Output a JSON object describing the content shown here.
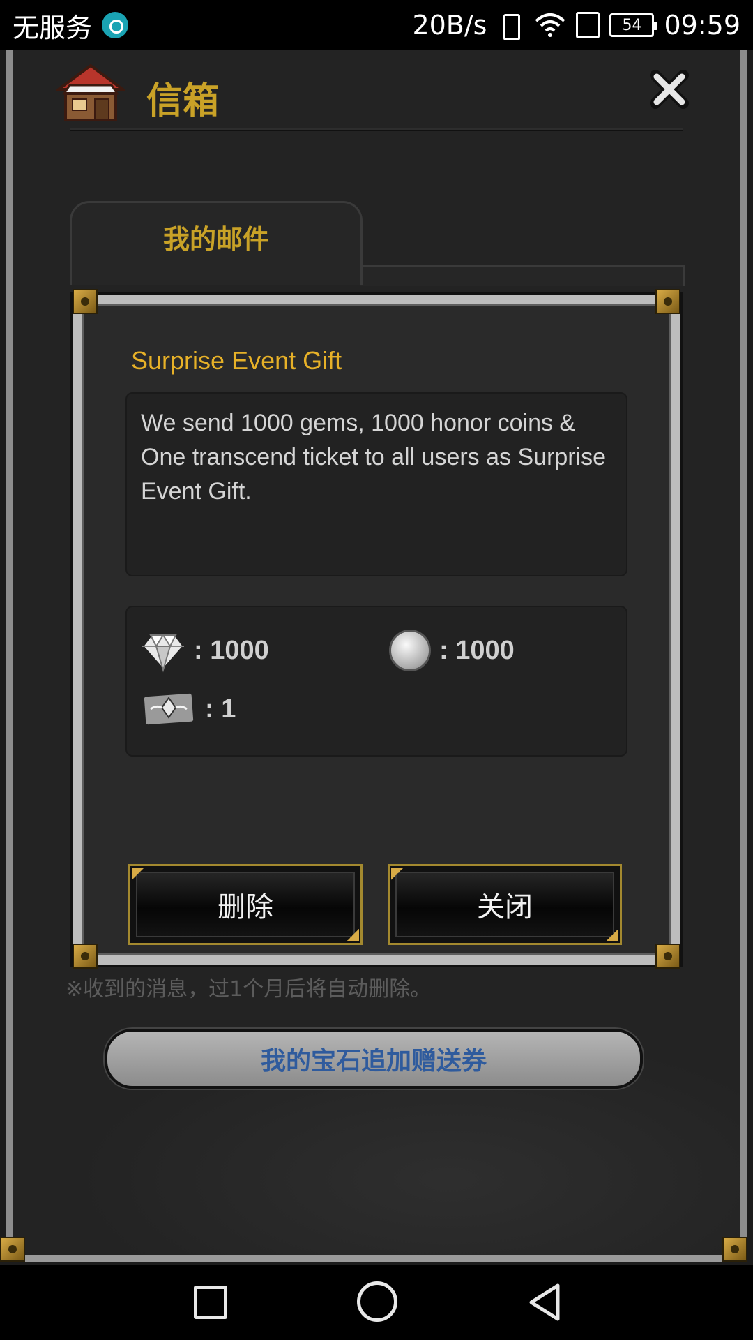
{
  "status_bar": {
    "carrier": "无服务",
    "speed": "20B/s",
    "battery": "54",
    "time": "09:59"
  },
  "header": {
    "title": "信箱",
    "icons": {
      "shop": "shop-house-icon",
      "close": "close-icon"
    }
  },
  "tab": {
    "label": "我的邮件"
  },
  "mail": {
    "title": "Surprise Event Gift",
    "body": "We send 1000 gems, 1000 honor coins & One transcend ticket to all users as Surprise Event Gift.",
    "rewards": [
      {
        "icon": "gem-icon",
        "value": ": 1000"
      },
      {
        "icon": "honor-coin-icon",
        "value": ": 1000"
      },
      {
        "icon": "transcend-ticket-icon",
        "value": ": 1"
      }
    ],
    "delete_label": "删除",
    "close_label": "关闭"
  },
  "footnote": "※收到的消息，过1个月后将自动删除。",
  "gem_coupon_label": "我的宝石追加赠送券",
  "colors": {
    "gold": "#c9a227",
    "mail_title": "#e7b128",
    "coupon_text": "#2f5b9d",
    "frame": "#bdbdbd"
  }
}
